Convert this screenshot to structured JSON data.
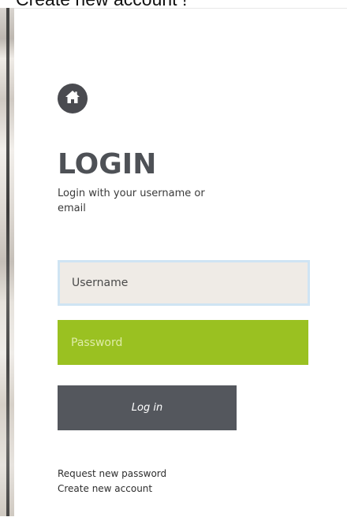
{
  "header": {
    "clipped_text": "Create new account !"
  },
  "icon": {
    "name": "home-icon",
    "badge_color": "#4a4b50"
  },
  "login": {
    "title": "LOGIN",
    "subtitle": "Login with your username or email"
  },
  "form": {
    "username": {
      "placeholder": "Username",
      "value": ""
    },
    "password": {
      "placeholder": "Password",
      "value": ""
    },
    "submit_label": "Log in"
  },
  "links": {
    "request_password": "Request new password",
    "create_account": "Create new account"
  },
  "colors": {
    "accent_green": "#9ac121",
    "button_gray": "#54575d",
    "title_gray": "#4e5156",
    "field_bg": "#efebe6",
    "focus_border": "#cfe4f3"
  }
}
